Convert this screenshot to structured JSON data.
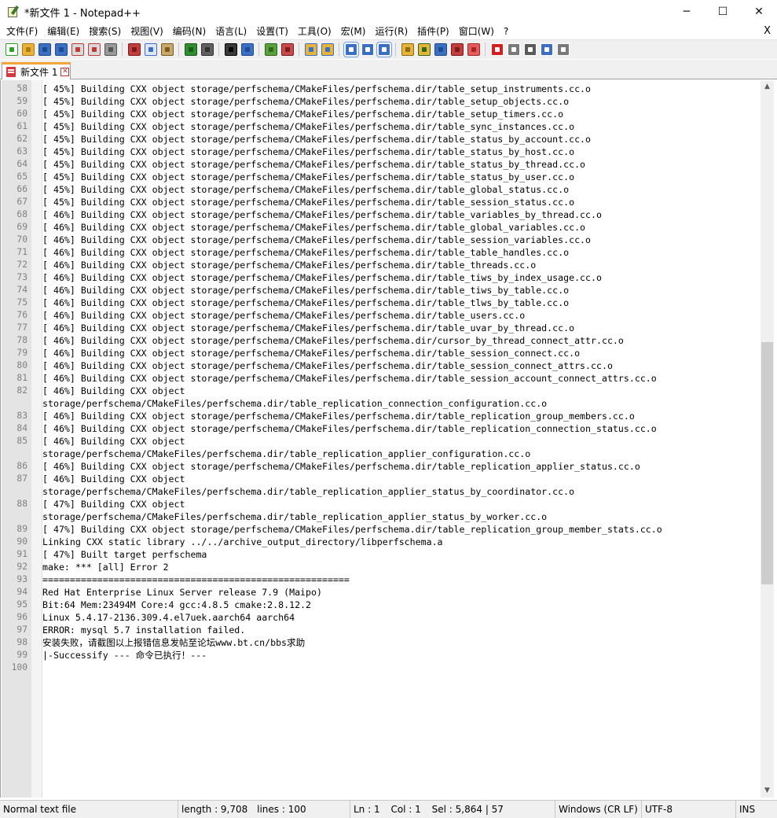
{
  "window": {
    "title": "*新文件 1 - Notepad++",
    "minimize_glyph": "─",
    "maximize_glyph": "☐",
    "close_glyph": "✕"
  },
  "menu": {
    "items": [
      "文件(F)",
      "编辑(E)",
      "搜索(S)",
      "视图(V)",
      "编码(N)",
      "语言(L)",
      "设置(T)",
      "工具(O)",
      "宏(M)",
      "运行(R)",
      "插件(P)",
      "窗口(W)",
      "?"
    ],
    "close_label": "X"
  },
  "toolbar": {
    "icons": [
      {
        "name": "new-file-icon",
        "color": "#ffffff",
        "accent": "#2f9e2f"
      },
      {
        "name": "open-file-icon",
        "color": "#e8b33a",
        "accent": "#b07c12"
      },
      {
        "name": "save-icon",
        "color": "#3b6fc4",
        "accent": "#1e4a8f"
      },
      {
        "name": "save-all-icon",
        "color": "#3b6fc4",
        "accent": "#1e4a8f"
      },
      {
        "name": "close-icon",
        "color": "#d9d9d9",
        "accent": "#c03a3a"
      },
      {
        "name": "close-all-icon",
        "color": "#d9d9d9",
        "accent": "#c03a3a"
      },
      {
        "name": "print-icon",
        "color": "#9a9a9a",
        "accent": "#555555"
      },
      {
        "name": "sep"
      },
      {
        "name": "cut-icon",
        "color": "#c43c3c",
        "accent": "#7a1c1c"
      },
      {
        "name": "copy-icon",
        "color": "#dfe6f4",
        "accent": "#3b6fc4"
      },
      {
        "name": "paste-icon",
        "color": "#c9a96a",
        "accent": "#7a5c22"
      },
      {
        "name": "sep"
      },
      {
        "name": "undo-icon",
        "color": "#2f8f2f",
        "accent": "#1c5a1c"
      },
      {
        "name": "redo-icon",
        "color": "#606060",
        "accent": "#303030"
      },
      {
        "name": "sep"
      },
      {
        "name": "find-icon",
        "color": "#3a3a3a",
        "accent": "#000000"
      },
      {
        "name": "replace-icon",
        "color": "#3b6fc4",
        "accent": "#1e4a8f"
      },
      {
        "name": "sep"
      },
      {
        "name": "zoom-in-icon",
        "color": "#5aa03c",
        "accent": "#2f6a1c"
      },
      {
        "name": "zoom-out-icon",
        "color": "#c84a4a",
        "accent": "#7a1c1c"
      },
      {
        "name": "sep"
      },
      {
        "name": "sync-vertical-icon",
        "color": "#e8b33a",
        "accent": "#3b6fc4"
      },
      {
        "name": "sync-horizontal-icon",
        "color": "#e8b33a",
        "accent": "#3b6fc4"
      },
      {
        "name": "sep"
      },
      {
        "name": "word-wrap-icon",
        "color": "#3b6fc4",
        "accent": "#ffffff",
        "active": true
      },
      {
        "name": "show-all-chars-icon",
        "color": "#3b6fc4",
        "accent": "#ffffff"
      },
      {
        "name": "indent-guide-icon",
        "color": "#3b6fc4",
        "accent": "#ffffff",
        "active": true
      },
      {
        "name": "sep"
      },
      {
        "name": "user-language-icon",
        "color": "#e8b33a",
        "accent": "#8a6a12"
      },
      {
        "name": "document-map-icon",
        "color": "#e8b33a",
        "accent": "#2f6a1c"
      },
      {
        "name": "function-list-icon",
        "color": "#3b6fc4",
        "accent": "#1e4a8f"
      },
      {
        "name": "folder-workspace-icon",
        "color": "#c43c3c",
        "accent": "#7a1c1c"
      },
      {
        "name": "monitoring-icon",
        "color": "#e85a5a",
        "accent": "#a02a2a"
      },
      {
        "name": "sep"
      },
      {
        "name": "record-macro-icon",
        "color": "#d02020",
        "accent": "#ffffff"
      },
      {
        "name": "stop-macro-icon",
        "color": "#7a7a7a",
        "accent": "#ffffff"
      },
      {
        "name": "play-macro-icon",
        "color": "#5a5a5a",
        "accent": "#ffffff"
      },
      {
        "name": "run-macro-multiple-icon",
        "color": "#3b6fc4",
        "accent": "#ffffff"
      },
      {
        "name": "save-macro-icon",
        "color": "#7a7a7a",
        "accent": "#ffffff"
      }
    ]
  },
  "tabs": [
    {
      "label": "新文件 1",
      "active": true,
      "close_glyph": "✕",
      "accent": "#f4a53a"
    }
  ],
  "editor": {
    "lines": [
      {
        "num": "58",
        "text": "[ 45%] Building CXX object storage/perfschema/CMakeFiles/perfschema.dir/table_setup_instruments.cc.o"
      },
      {
        "num": "59",
        "text": "[ 45%] Building CXX object storage/perfschema/CMakeFiles/perfschema.dir/table_setup_objects.cc.o"
      },
      {
        "num": "60",
        "text": "[ 45%] Building CXX object storage/perfschema/CMakeFiles/perfschema.dir/table_setup_timers.cc.o"
      },
      {
        "num": "61",
        "text": "[ 45%] Building CXX object storage/perfschema/CMakeFiles/perfschema.dir/table_sync_instances.cc.o"
      },
      {
        "num": "62",
        "text": "[ 45%] Building CXX object storage/perfschema/CMakeFiles/perfschema.dir/table_status_by_account.cc.o"
      },
      {
        "num": "63",
        "text": "[ 45%] Building CXX object storage/perfschema/CMakeFiles/perfschema.dir/table_status_by_host.cc.o"
      },
      {
        "num": "64",
        "text": "[ 45%] Building CXX object storage/perfschema/CMakeFiles/perfschema.dir/table_status_by_thread.cc.o"
      },
      {
        "num": "65",
        "text": "[ 45%] Building CXX object storage/perfschema/CMakeFiles/perfschema.dir/table_status_by_user.cc.o"
      },
      {
        "num": "66",
        "text": "[ 45%] Building CXX object storage/perfschema/CMakeFiles/perfschema.dir/table_global_status.cc.o"
      },
      {
        "num": "67",
        "text": "[ 45%] Building CXX object storage/perfschema/CMakeFiles/perfschema.dir/table_session_status.cc.o"
      },
      {
        "num": "68",
        "text": "[ 46%] Building CXX object storage/perfschema/CMakeFiles/perfschema.dir/table_variables_by_thread.cc.o"
      },
      {
        "num": "69",
        "text": "[ 46%] Building CXX object storage/perfschema/CMakeFiles/perfschema.dir/table_global_variables.cc.o"
      },
      {
        "num": "70",
        "text": "[ 46%] Building CXX object storage/perfschema/CMakeFiles/perfschema.dir/table_session_variables.cc.o"
      },
      {
        "num": "71",
        "text": "[ 46%] Building CXX object storage/perfschema/CMakeFiles/perfschema.dir/table_table_handles.cc.o"
      },
      {
        "num": "72",
        "text": "[ 46%] Building CXX object storage/perfschema/CMakeFiles/perfschema.dir/table_threads.cc.o"
      },
      {
        "num": "73",
        "text": "[ 46%] Building CXX object storage/perfschema/CMakeFiles/perfschema.dir/table_tiws_by_index_usage.cc.o"
      },
      {
        "num": "74",
        "text": "[ 46%] Building CXX object storage/perfschema/CMakeFiles/perfschema.dir/table_tiws_by_table.cc.o"
      },
      {
        "num": "75",
        "text": "[ 46%] Building CXX object storage/perfschema/CMakeFiles/perfschema.dir/table_tlws_by_table.cc.o"
      },
      {
        "num": "76",
        "text": "[ 46%] Building CXX object storage/perfschema/CMakeFiles/perfschema.dir/table_users.cc.o"
      },
      {
        "num": "77",
        "text": "[ 46%] Building CXX object storage/perfschema/CMakeFiles/perfschema.dir/table_uvar_by_thread.cc.o"
      },
      {
        "num": "78",
        "text": "[ 46%] Building CXX object storage/perfschema/CMakeFiles/perfschema.dir/cursor_by_thread_connect_attr.cc.o"
      },
      {
        "num": "79",
        "text": "[ 46%] Building CXX object storage/perfschema/CMakeFiles/perfschema.dir/table_session_connect.cc.o"
      },
      {
        "num": "80",
        "text": "[ 46%] Building CXX object storage/perfschema/CMakeFiles/perfschema.dir/table_session_connect_attrs.cc.o"
      },
      {
        "num": "81",
        "text": "[ 46%] Building CXX object storage/perfschema/CMakeFiles/perfschema.dir/table_session_account_connect_attrs.cc.o"
      },
      {
        "num": "82",
        "text": "[ 46%] Building CXX object"
      },
      {
        "num": "",
        "text": "storage/perfschema/CMakeFiles/perfschema.dir/table_replication_connection_configuration.cc.o"
      },
      {
        "num": "83",
        "text": "[ 46%] Building CXX object storage/perfschema/CMakeFiles/perfschema.dir/table_replication_group_members.cc.o"
      },
      {
        "num": "84",
        "text": "[ 46%] Building CXX object storage/perfschema/CMakeFiles/perfschema.dir/table_replication_connection_status.cc.o"
      },
      {
        "num": "85",
        "text": "[ 46%] Building CXX object"
      },
      {
        "num": "",
        "text": "storage/perfschema/CMakeFiles/perfschema.dir/table_replication_applier_configuration.cc.o"
      },
      {
        "num": "86",
        "text": "[ 46%] Building CXX object storage/perfschema/CMakeFiles/perfschema.dir/table_replication_applier_status.cc.o"
      },
      {
        "num": "87",
        "text": "[ 46%] Building CXX object"
      },
      {
        "num": "",
        "text": "storage/perfschema/CMakeFiles/perfschema.dir/table_replication_applier_status_by_coordinator.cc.o"
      },
      {
        "num": "88",
        "text": "[ 47%] Building CXX object"
      },
      {
        "num": "",
        "text": "storage/perfschema/CMakeFiles/perfschema.dir/table_replication_applier_status_by_worker.cc.o"
      },
      {
        "num": "89",
        "text": "[ 47%] Building CXX object storage/perfschema/CMakeFiles/perfschema.dir/table_replication_group_member_stats.cc.o"
      },
      {
        "num": "90",
        "text": "Linking CXX static library ../../archive_output_directory/libperfschema.a"
      },
      {
        "num": "91",
        "text": "[ 47%] Built target perfschema"
      },
      {
        "num": "92",
        "text": "make: *** [all] Error 2"
      },
      {
        "num": "93",
        "text": "========================================================"
      },
      {
        "num": "94",
        "text": "Red Hat Enterprise Linux Server release 7.9 (Maipo)"
      },
      {
        "num": "95",
        "text": "Bit:64 Mem:23494M Core:4 gcc:4.8.5 cmake:2.8.12.2"
      },
      {
        "num": "96",
        "text": "Linux 5.4.17-2136.309.4.el7uek.aarch64 aarch64"
      },
      {
        "num": "97",
        "text": "ERROR: mysql 5.7 installation failed."
      },
      {
        "num": "98",
        "text": "安装失败，请截图以上报错信息发帖至论坛www.bt.cn/bbs求助"
      },
      {
        "num": "99",
        "text": "|-Successify --- 命令已执行！---"
      },
      {
        "num": "100",
        "text": ""
      }
    ]
  },
  "scrollbar": {
    "up_glyph": "▲",
    "down_glyph": "▼"
  },
  "status": {
    "file_type": "Normal text file",
    "length": "length : 9,708",
    "lines": "lines : 100",
    "ln": "Ln : 1",
    "col": "Col : 1",
    "sel": "Sel : 5,864 | 57",
    "eol": "Windows (CR LF)",
    "encoding": "UTF-8",
    "mode": "INS"
  }
}
